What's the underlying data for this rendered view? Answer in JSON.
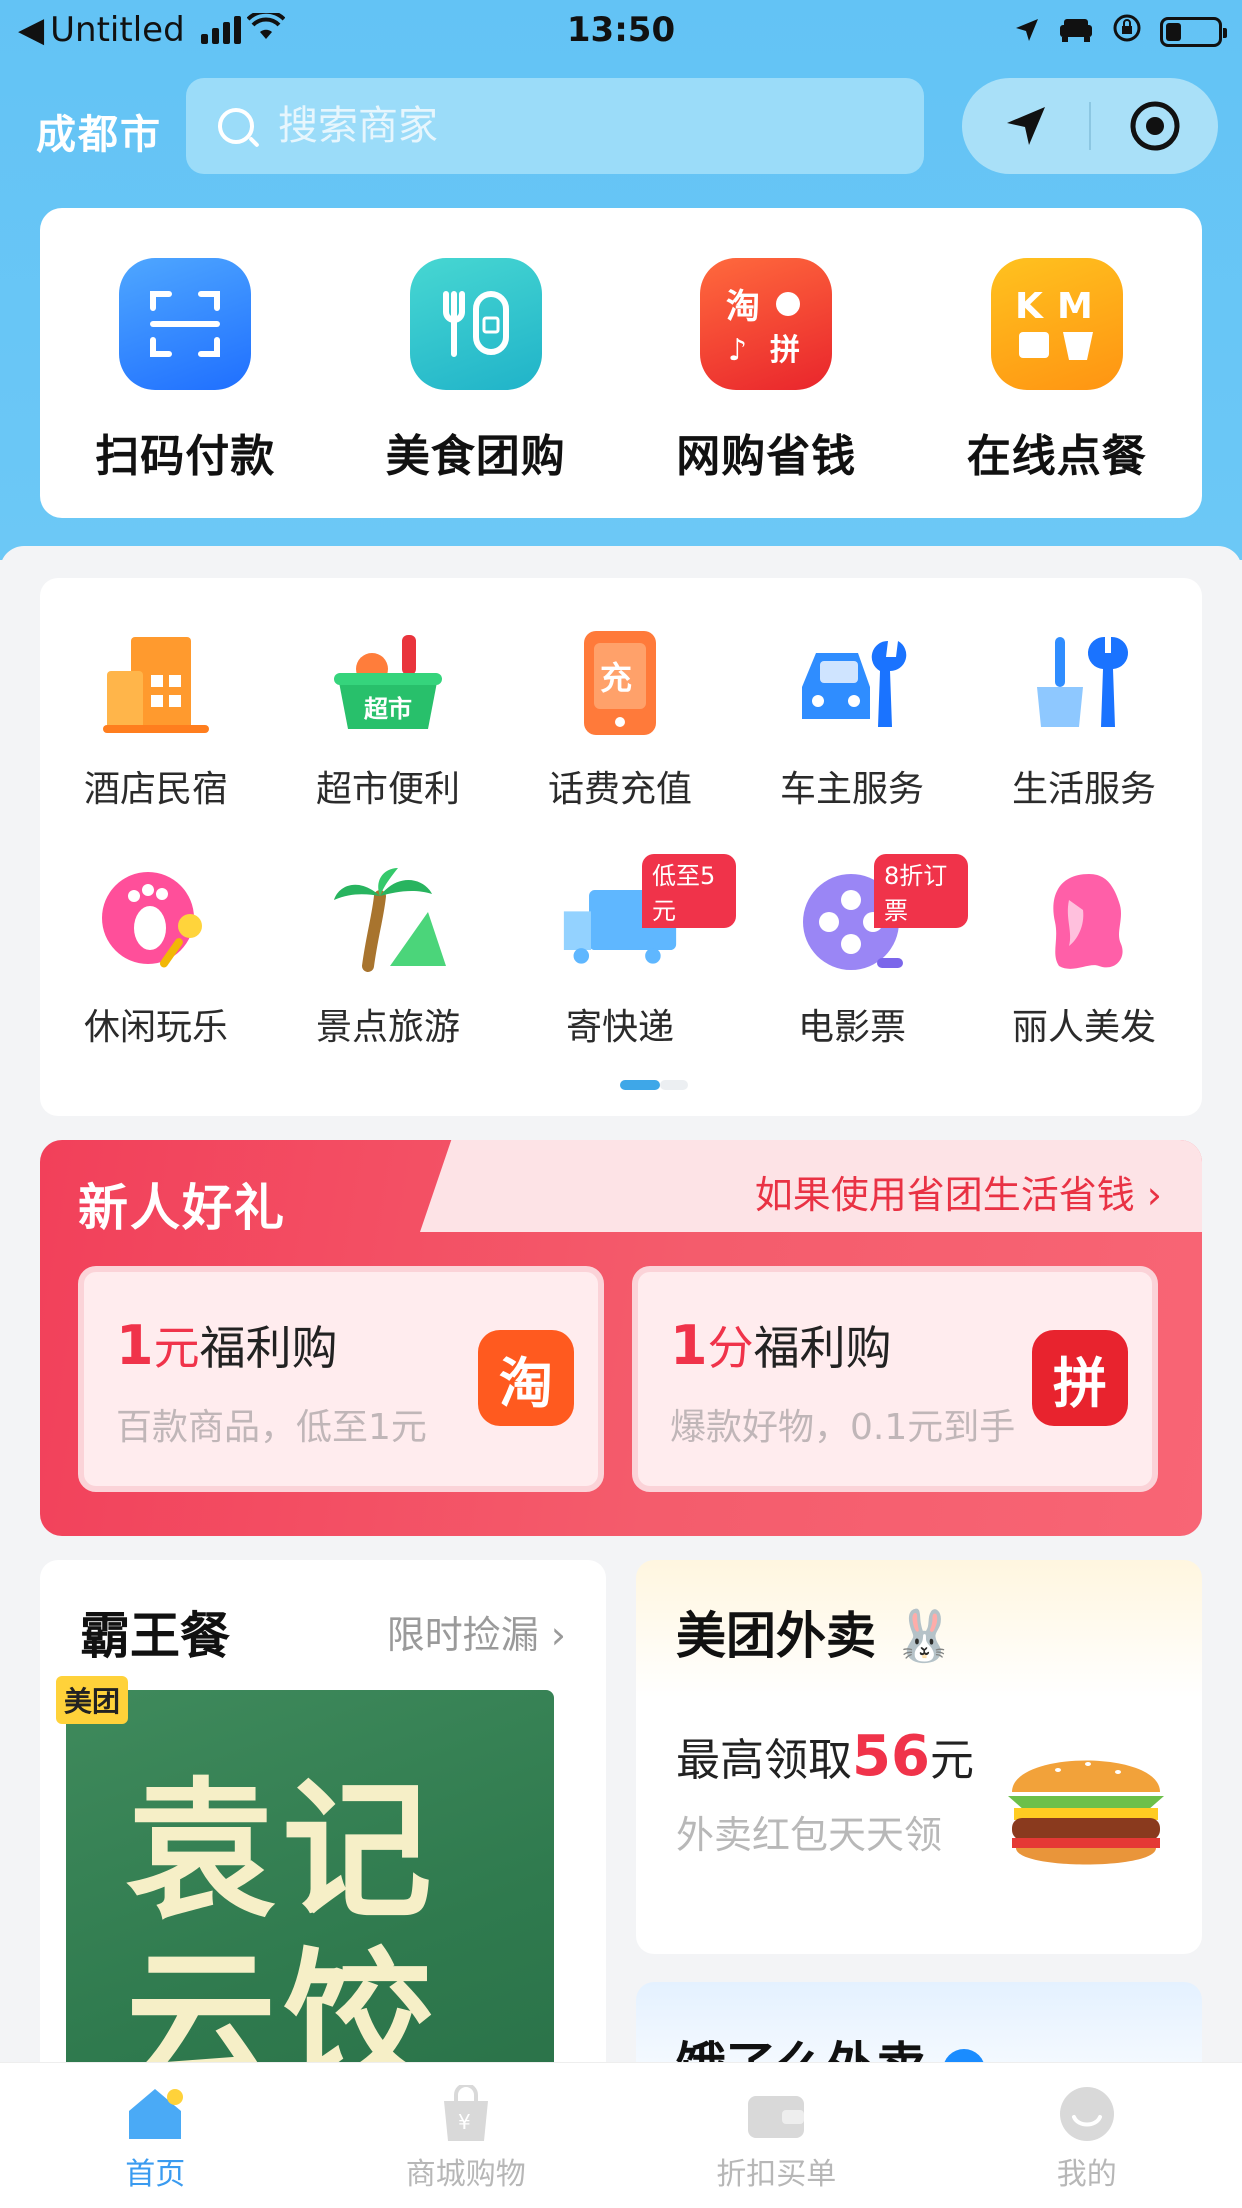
{
  "status_bar": {
    "back_app": "Untitled",
    "time": "13:50"
  },
  "header": {
    "city": "成都市",
    "search_placeholder": "搜索商家"
  },
  "quick_actions": [
    {
      "label": "扫码付款",
      "icon": "scan-icon"
    },
    {
      "label": "美食团购",
      "icon": "food-group-icon"
    },
    {
      "label": "网购省钱",
      "icon": "online-shopping-icon"
    },
    {
      "label": "在线点餐",
      "icon": "online-order-icon"
    }
  ],
  "services": [
    {
      "label": "酒店民宿",
      "icon": "hotel-icon",
      "badge": ""
    },
    {
      "label": "超市便利",
      "icon": "supermarket-icon",
      "badge": ""
    },
    {
      "label": "话费充值",
      "icon": "phone-recharge-icon",
      "badge": ""
    },
    {
      "label": "车主服务",
      "icon": "car-service-icon",
      "badge": ""
    },
    {
      "label": "生活服务",
      "icon": "life-service-icon",
      "badge": ""
    },
    {
      "label": "休闲玩乐",
      "icon": "leisure-icon",
      "badge": ""
    },
    {
      "label": "景点旅游",
      "icon": "travel-icon",
      "badge": ""
    },
    {
      "label": "寄快递",
      "icon": "express-icon",
      "badge": "低至5元"
    },
    {
      "label": "电影票",
      "icon": "movie-icon",
      "badge": "8折订票"
    },
    {
      "label": "丽人美发",
      "icon": "beauty-icon",
      "badge": ""
    }
  ],
  "promo": {
    "title": "新人好礼",
    "link": "如果使用省团生活省钱",
    "coupons": [
      {
        "amount": "1",
        "unit": "元",
        "label": "福利购",
        "sub": "百款商品，低至1元",
        "logo_text": "淘",
        "logo_color": "#ff5a1f"
      },
      {
        "amount": "1",
        "unit": "分",
        "label": "福利购",
        "sub": "爆款好物，0.1元到手",
        "logo_text": "拼",
        "logo_color": "#e8232e"
      }
    ]
  },
  "bawangcan": {
    "title": "霸王餐",
    "more": "限时捡漏",
    "tag": "美团",
    "poster_line1": "袁记",
    "poster_line2": "云饺"
  },
  "meituan": {
    "title": "美团外卖",
    "offer_prefix": "最高领取",
    "offer_amount": "56",
    "offer_unit": "元",
    "sub": "外卖红包天天领"
  },
  "eleme": {
    "title": "饿了么外卖"
  },
  "tabs": [
    {
      "label": "首页",
      "icon": "home-icon",
      "active": true
    },
    {
      "label": "商城购物",
      "icon": "shopping-bag-icon",
      "active": false
    },
    {
      "label": "折扣买单",
      "icon": "wallet-icon",
      "active": false
    },
    {
      "label": "我的",
      "icon": "profile-icon",
      "active": false
    }
  ],
  "colors": {
    "header_blue": "#63c3f5",
    "accent_red": "#f0334a",
    "tab_active": "#3a9bf0"
  }
}
